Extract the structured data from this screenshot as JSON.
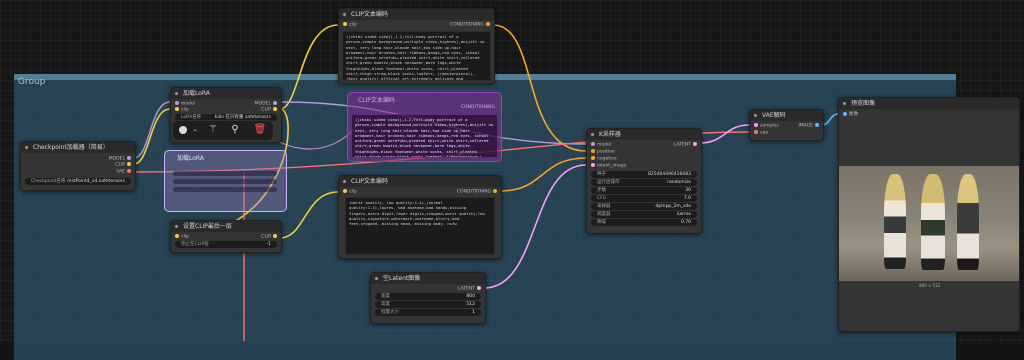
{
  "group": {
    "title": "Group"
  },
  "nodes": {
    "clip_text_top": {
      "title": "CLIP文本编码",
      "input_label": "clip",
      "output_label": "CONDITIONING",
      "text": "((chibi sided view)),1.2,full-body portrait of a person,simple background,multiple views,highres),anijitt no next, very long hair,blonde hair,two side up,hair ornament,hair brushes,hair ribbons,bangs,red eyes, school uniform,green serafuku,pleated skirt,white shirt,collared shirt,green bowtie,black neckwear,bare legs,white thighhighs,black footwear,white socks, shirt,pleated skirt,thigh strap,black socks,loafers, ((masterpiece)), (best quality),official art,extremely delicate and beautiful,extremely detailed CG,ultra detailed,beautiful detailed eyes,extremely detailed face,(girl),solo,very long hair blonde hair two side up hair ornament hair brushes"
    },
    "lora": {
      "title": "加载LoRA",
      "inputs": [
        "model",
        "clip"
      ],
      "outputs": [
        "MODEL",
        "CLIP"
      ],
      "lora_label": "LoRA名称",
      "lora_value": "kilin 在只有重 safetensors"
    },
    "lora_ghost": {
      "title": "加载LoRA"
    },
    "clip_text_ghost": {
      "title": "CLIP文本编码",
      "output_label": "CONDITIONING"
    },
    "checkpoint": {
      "title": "Checkpoint加载器（简易）",
      "outputs": [
        "MODEL",
        "CLIP",
        "VAE"
      ],
      "ckpt_label": "Checkpoint名称",
      "ckpt_value": "midPoint4_v4.safetensors"
    },
    "clip_skip": {
      "title": "设置CLIP最后一层",
      "input_label": "clip",
      "output_label": "CLIP",
      "widget_label": "停止在CLIP层",
      "widget_value": "-1"
    },
    "clip_text_neg": {
      "title": "CLIP文本编码",
      "input_label": "clip",
      "output_label": "CONDITIONING",
      "text": "(worst quality, low quality:1.4),(normal quality:1.4),lowres, bad anatomy,bad hands,missing fingers,extra digit,fewer digits,cropped,worst quality,low quality,signature,watermark,username,blurry,bad feet,cropped, missing head, missing body, nsfw"
    },
    "ksampler": {
      "title": "K采样器",
      "inputs": [
        "model",
        "positive",
        "negative",
        "latent_image"
      ],
      "output_label": "LATENT",
      "widgets": [
        {
          "label": "种子",
          "value": "825404496416083"
        },
        {
          "label": "运行后操作",
          "value": "randomize"
        },
        {
          "label": "步数",
          "value": "30"
        },
        {
          "label": "CFG",
          "value": "7.0"
        },
        {
          "label": "采样器",
          "value": "dpmpp_2m_sde"
        },
        {
          "label": "调度器",
          "value": "karras"
        },
        {
          "label": "降噪",
          "value": "0.70"
        }
      ]
    },
    "empty_latent": {
      "title": "空Latent图像",
      "output_label": "LATENT",
      "widgets": [
        {
          "label": "宽度",
          "value": "800"
        },
        {
          "label": "高度",
          "value": "512"
        },
        {
          "label": "批量大小",
          "value": "1"
        }
      ]
    },
    "vae_decode": {
      "title": "VAE解码",
      "inputs": [
        "samples",
        "vae"
      ],
      "output_label": "IMAGE"
    },
    "preview": {
      "title": "预览图像",
      "input_label": "图像",
      "size_label": "800 × 512"
    }
  },
  "toolbar": {
    "icons": [
      "color-circle-icon",
      "chevron-down-icon",
      "wand-icon",
      "pin-icon",
      "trash-icon"
    ]
  },
  "colors": {
    "group_bg": "#356886",
    "clip_wire": "#f2d032",
    "conditioning_wire": "#f5a623",
    "vae_wire": "#ff6e6e",
    "latent_wire": "#ff9cf9",
    "model_wire": "#b39ddb",
    "image_wire": "#64b5f6",
    "selection": "#8a2be2"
  }
}
